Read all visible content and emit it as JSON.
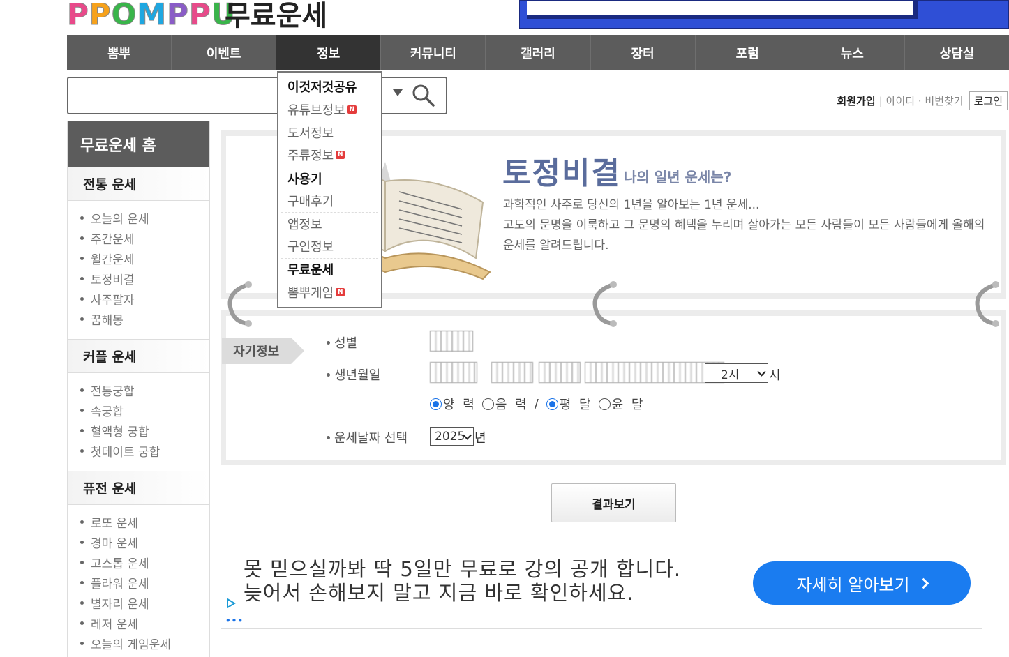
{
  "header": {
    "logo_text": "PPOMPPU",
    "site_title": "무료운세"
  },
  "nav": {
    "items": [
      "뽐뿌",
      "이벤트",
      "정보",
      "커뮤니티",
      "갤러리",
      "장터",
      "포럼",
      "뉴스",
      "상담실"
    ],
    "active": "정보"
  },
  "dropdown": {
    "items": [
      {
        "label": "이것저것공유",
        "head": true
      },
      {
        "label": "유튜브정보",
        "new": true
      },
      {
        "label": "도서정보"
      },
      {
        "label": "주류정보",
        "new": true
      },
      {
        "label": "사용기",
        "head": true
      },
      {
        "label": "구매후기"
      },
      {
        "label": "앱정보"
      },
      {
        "label": "구인정보"
      },
      {
        "label": "무료운세",
        "head": true
      },
      {
        "label": "뽐뿌게임",
        "new": true
      }
    ],
    "new_badge": "N"
  },
  "login": {
    "join": "회원가입",
    "find": "아이디 · 비번찾기",
    "login_button": "로그인"
  },
  "sidebar": {
    "home": "무료운세 홈",
    "sections": [
      {
        "title": "전통 운세",
        "items": [
          "오늘의 운세",
          "주간운세",
          "월간운세",
          "토정비결",
          "사주팔자",
          "꿈해몽"
        ]
      },
      {
        "title": "커플 운세",
        "items": [
          "전통궁합",
          "속궁합",
          "혈액형 궁합",
          "첫데이트 궁합"
        ]
      },
      {
        "title": "퓨전 운세",
        "items": [
          "로또 운세",
          "경마 운세",
          "고스톱 운세",
          "플라워 운세",
          "별자리 운세",
          "레저 운세",
          "오늘의 게임운세"
        ]
      }
    ]
  },
  "hero": {
    "title": "토정비결",
    "subtitle": "나의 일년 운세는?",
    "desc_line1": "과학적인 사주로 당신의 1년을 알아보는 1년 운세...",
    "desc_line2": "고도의 문명을 이룩하고 그 문명의 혜택을 누리며 살아가는 모든 사람들이 모든 사람들에게 올해의 운세를 알려드립니다."
  },
  "form": {
    "tab_label": "자기정보",
    "gender_label": "성별",
    "birth_label": "생년월일",
    "hour_value": "2시",
    "hour_suffix": "시",
    "calendar_options": [
      "양 력",
      "음 력"
    ],
    "calendar_selected": "양 력",
    "divider": "/",
    "month_options": [
      "평 달",
      "윤 달"
    ],
    "month_selected": "평 달",
    "year_label": "운세날짜 선택",
    "year_value": "2025",
    "year_suffix": "년",
    "submit_label": "결과보기"
  },
  "ad": {
    "line1": "못 믿으실까봐 딱 5일만 무료로 강의 공개 합니다.",
    "line2": "늦어서 손해보지 말고 지금 바로 확인하세요.",
    "cta": "자세히 알아보기"
  }
}
